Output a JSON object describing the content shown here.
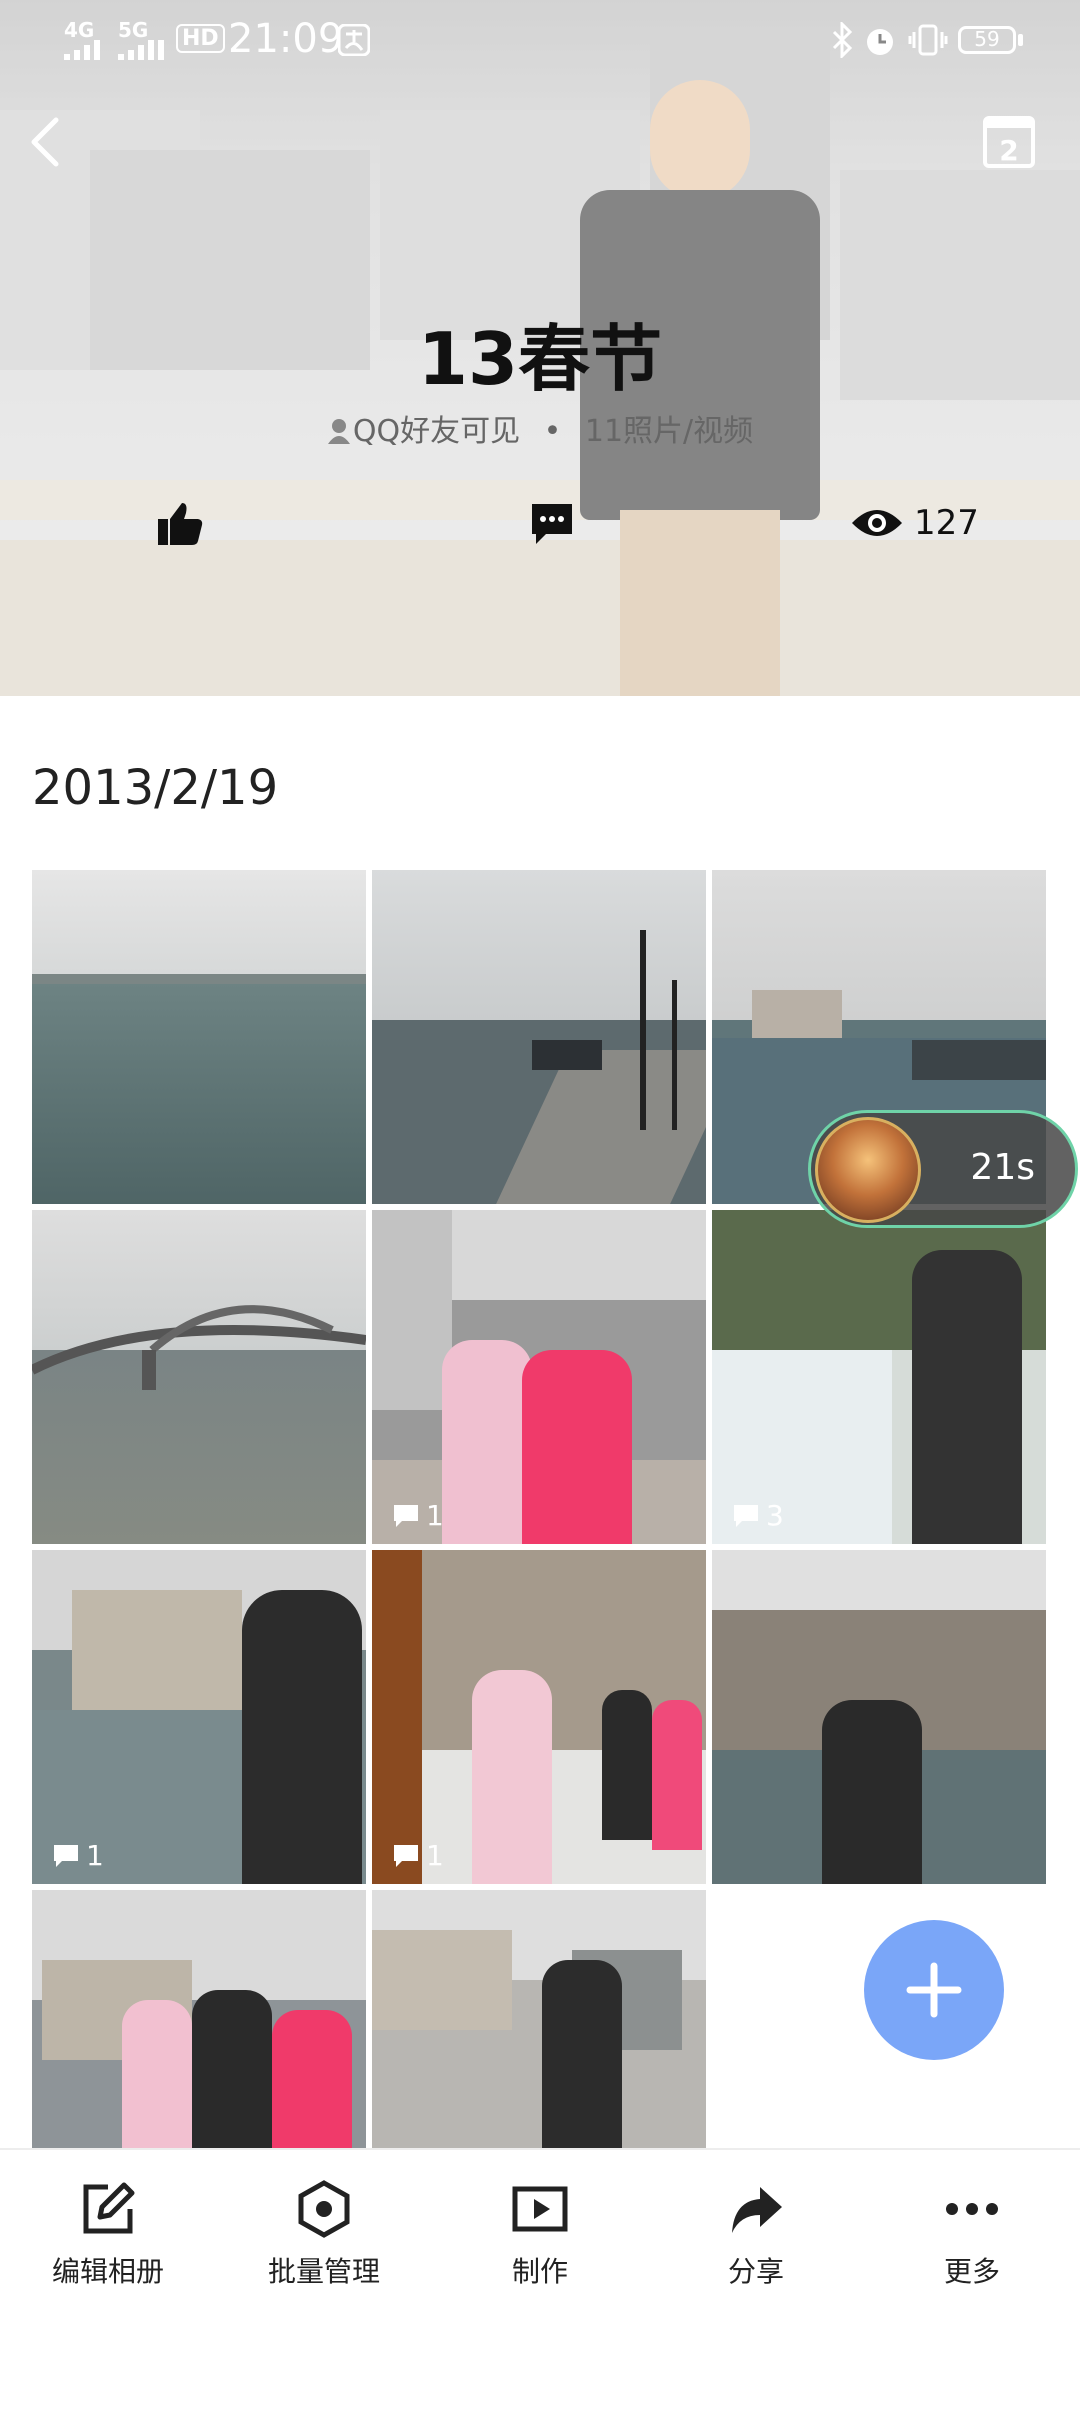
{
  "status_bar": {
    "network1": "4G",
    "network2": "5G",
    "hd": "HD",
    "time": "21:09",
    "battery": "59"
  },
  "album": {
    "title": "13春节",
    "visibility": "QQ好友可见",
    "separator": "•",
    "count": "11照片/视频",
    "views": "127"
  },
  "date_group": "2013/2/19",
  "photos": [
    {
      "comments": ""
    },
    {
      "comments": ""
    },
    {
      "comments": ""
    },
    {
      "comments": ""
    },
    {
      "comments": "1"
    },
    {
      "comments": "3"
    },
    {
      "comments": "1"
    },
    {
      "comments": "1"
    },
    {
      "comments": ""
    },
    {
      "comments": ""
    },
    {
      "comments": ""
    }
  ],
  "floating_timer": {
    "text": "21s"
  },
  "bottom_bar": {
    "edit_album": "编辑相册",
    "batch_manage": "批量管理",
    "make": "制作",
    "share": "分享",
    "more": "更多"
  },
  "icons": {
    "back": "back-arrow-icon",
    "calendar": "calendar-icon",
    "like": "thumbs-up-icon",
    "comment": "comment-icon",
    "views": "eye-icon",
    "add": "plus-icon"
  }
}
